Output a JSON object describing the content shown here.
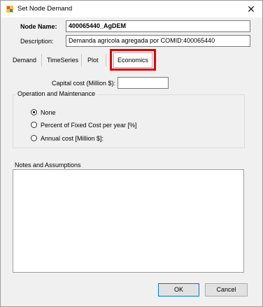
{
  "window": {
    "title": "Set Node Demand",
    "close_symbol": "✕"
  },
  "node": {
    "name_label": "Node Name:",
    "name_value": "400065440_AgDEM",
    "description_label": "Description:",
    "description_value": "Demanda agricola agregada por COMID:400065440"
  },
  "tabs": [
    {
      "label": "Demand"
    },
    {
      "label": "TimeSeries"
    },
    {
      "label": "Plot"
    },
    {
      "label": "Economics"
    }
  ],
  "economics": {
    "capital_cost_label": "Capital cost (Million $):",
    "capital_cost_value": "",
    "om_group_title": "Operation and Maintenance",
    "options": [
      {
        "label": "None",
        "checked": true
      },
      {
        "label": "Percent of Fixed Cost per year [%]",
        "checked": false
      },
      {
        "label": "Annual cost [Million $]:",
        "checked": false
      }
    ],
    "notes_title": "Notes and Assumptions",
    "notes_value": ""
  },
  "buttons": {
    "ok": "OK",
    "cancel": "Cancel"
  },
  "colors": {
    "highlight": "#e00000",
    "default_button_border": "#0078d7"
  }
}
